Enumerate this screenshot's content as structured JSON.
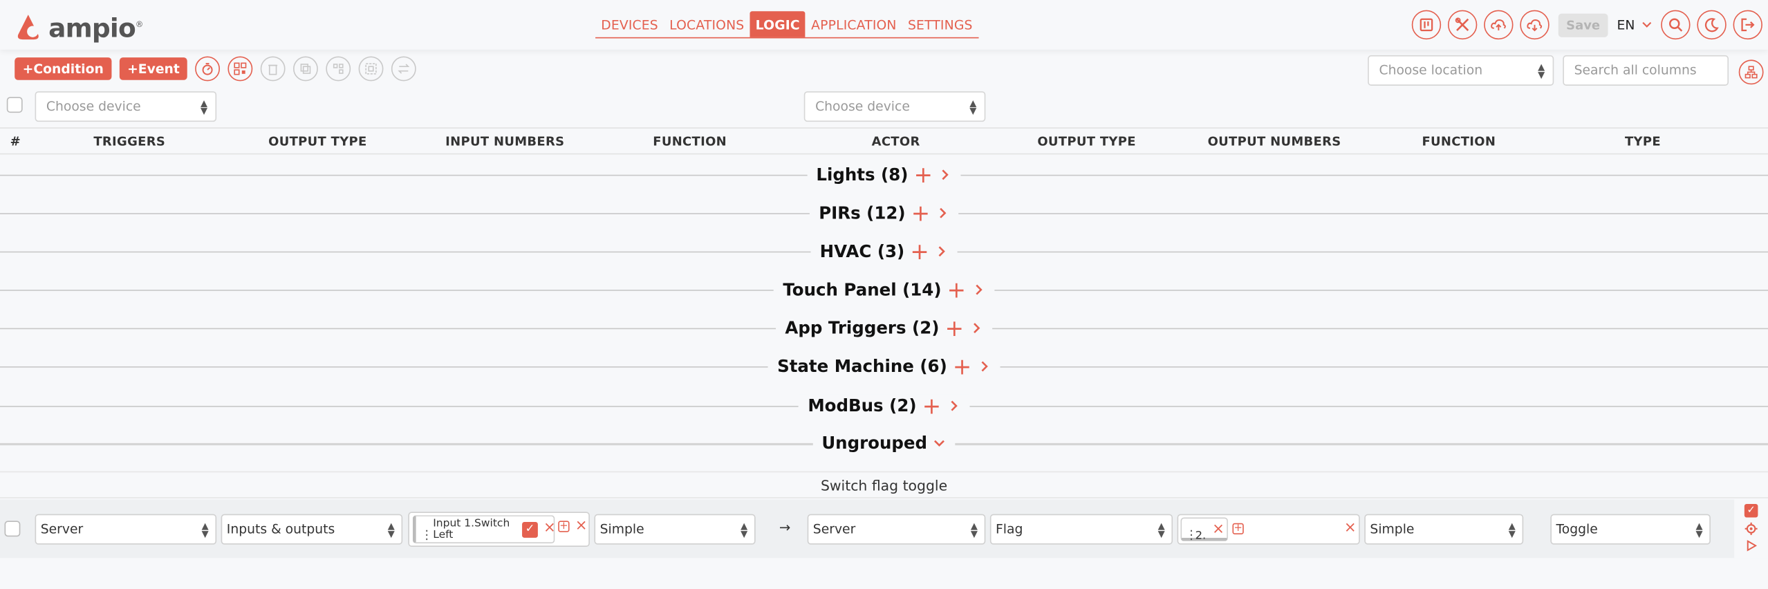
{
  "brand": {
    "name": "ampio",
    "trademark": "®"
  },
  "nav": {
    "items": [
      {
        "label": "DEVICES",
        "active": false
      },
      {
        "label": "LOCATIONS",
        "active": false
      },
      {
        "label": "LOGIC",
        "active": true
      },
      {
        "label": "APPLICATION",
        "active": false
      },
      {
        "label": "SETTINGS",
        "active": false
      }
    ]
  },
  "header": {
    "save_label": "Save",
    "language": "EN"
  },
  "toolbar": {
    "condition_label": "Condition",
    "event_label": "Event"
  },
  "filters": {
    "location_placeholder": "Choose location",
    "search_placeholder": "Search all columns",
    "trigger_device_placeholder": "Choose device",
    "actor_device_placeholder": "Choose device"
  },
  "columns": [
    "#",
    "TRIGGERS",
    "OUTPUT TYPE",
    "INPUT NUMBERS",
    "FUNCTION",
    "ACTOR",
    "OUTPUT TYPE",
    "OUTPUT NUMBERS",
    "FUNCTION",
    "TYPE"
  ],
  "groups": [
    {
      "label": "Lights (8)"
    },
    {
      "label": "PIRs (12)"
    },
    {
      "label": "HVAC (3)"
    },
    {
      "label": "Touch Panel (14)"
    },
    {
      "label": "App Triggers (2)"
    },
    {
      "label": "State Machine (6)"
    },
    {
      "label": "ModBus (2)"
    },
    {
      "label": "Ungrouped",
      "expanded": true
    }
  ],
  "rule": {
    "title": "Switch flag toggle",
    "trigger_device": "Server",
    "trigger_output_type": "Inputs & outputs",
    "input_number": "Input 1.Switch Left",
    "trigger_function": "Simple",
    "arrow": "→",
    "actor_device": "Server",
    "actor_output_type": "Flag",
    "output_number": "2.",
    "actor_function": "Simple",
    "type": "Toggle"
  },
  "colors": {
    "accent": "#e4604f",
    "background": "#f7f8fa",
    "row": "#eef0f2"
  }
}
